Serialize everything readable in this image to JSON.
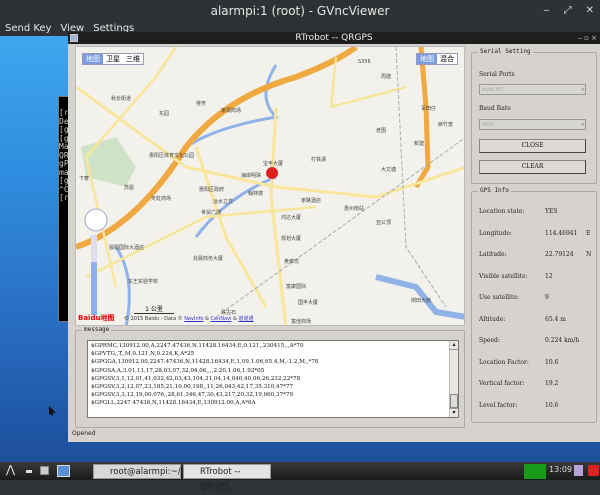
{
  "viewer": {
    "title": "alarmpi:1 (root) - GVncViewer",
    "menu": [
      "Send Key",
      "View",
      "Settings"
    ],
    "controls": [
      "‒",
      "⤢",
      "✕"
    ]
  },
  "terminal": {
    "lines": [
      "[r",
      "De",
      "[g",
      "[g",
      "Ma",
      "QR",
      "gP",
      "ma",
      "[g",
      "^C",
      "[r"
    ]
  },
  "app": {
    "title": "RTrobot -- QRGPS",
    "status": "Opened"
  },
  "map": {
    "type_buttons": [
      "地图",
      "卫星",
      "三维"
    ],
    "right_buttons": [
      "地图",
      "混合"
    ],
    "labels": [
      "秋长街道",
      "排芳",
      "家润商场",
      "东园",
      "周建",
      "军田仔",
      "麻竹笼",
      "惠阳区体育文化公园",
      "宝丰大厦",
      "打铁湖",
      "海岸明珠",
      "老围",
      "新建",
      "大文塘",
      "苏屋",
      "惠阳区政府",
      "翰林楼",
      "天虹商场",
      "淡水立交",
      "家路酒店",
      "惠州南站",
      "世贸广场",
      "鸿达大厦",
      "亚公顶",
      "下寮",
      "规划大厦",
      "骏阳国际大酒店",
      "兆晨商务大厦",
      "黄茉坑",
      "东王实验学校",
      "富康国际",
      "国丰大厦",
      "岗田大桥",
      "珠古石",
      "富佳商场",
      "S356"
    ],
    "scale": "1 公里",
    "copyright": "© 2015 Baidu - Data ©",
    "links": [
      "NavInfo",
      "CenNavi",
      "道道通"
    ],
    "logo": "Baidu地图"
  },
  "message": {
    "title": "message",
    "lines": [
      "$GPRMC,130912.00,A,2247.47436,N,11428.16434,E,0.121,,230415,,,A*70",
      "$GPVTG,,T,,M,0.121,N,0.224,K,A*25",
      "$GPGGA,130912.00,2247.47436,N,11428.16434,E,1,09,1.06,65.4,M,-1.2,M,,*78",
      "$GPGSA,A,3,01,11,17,28,03,07,32,04,06,,,,2.20,1.06,1.92*05",
      "$GPGSV,3,1,12,01,41,032,42,03,43,104,31,04,14,040,40,06,26,232,22*78",
      "$GPGSV,3,2,12,07,23,185,21,10,00,198,,11,26,043,42,17,35,310,47*77",
      "$GPGSV,3,3,12,19,00,076,,28,61,346,47,30,43,217,20,32,19,060,37*79",
      "$GPGLL,2247.47436,N,11428.16434,E,130912.00,A,A*6A"
    ]
  },
  "serial": {
    "title": "Serial Setting",
    "ports_label": "Serial Ports",
    "port": "ttyACM0",
    "baud_label": "Baud Rate",
    "baud": "9600",
    "close": "CLOSE",
    "clear": "CLEAR"
  },
  "gps": {
    "title": "GPS Info",
    "rows": [
      {
        "label": "Location state:",
        "value": "YES",
        "unit": ""
      },
      {
        "label": "Longitude:",
        "value": "114.46941",
        "unit": "E"
      },
      {
        "label": "Latitude:",
        "value": "22.79124",
        "unit": "N"
      },
      {
        "label": "Visible satellite:",
        "value": "12",
        "unit": ""
      },
      {
        "label": "Use  satellite:",
        "value": "9",
        "unit": ""
      },
      {
        "label": "Altitude:",
        "value": "65.4 m",
        "unit": ""
      },
      {
        "label": "Speed:",
        "value": "0.224 km/h",
        "unit": ""
      },
      {
        "label": "Location Factor:",
        "value": "10.6",
        "unit": ""
      },
      {
        "label": "Vertical factor:",
        "value": "19.2",
        "unit": ""
      },
      {
        "label": "Level factor:",
        "value": "10.6",
        "unit": ""
      }
    ]
  },
  "taskbar": {
    "tasks": [
      "root@alarmpi:~/bui...",
      "RTrobot -- QRGPS"
    ],
    "clock": "13:09"
  }
}
